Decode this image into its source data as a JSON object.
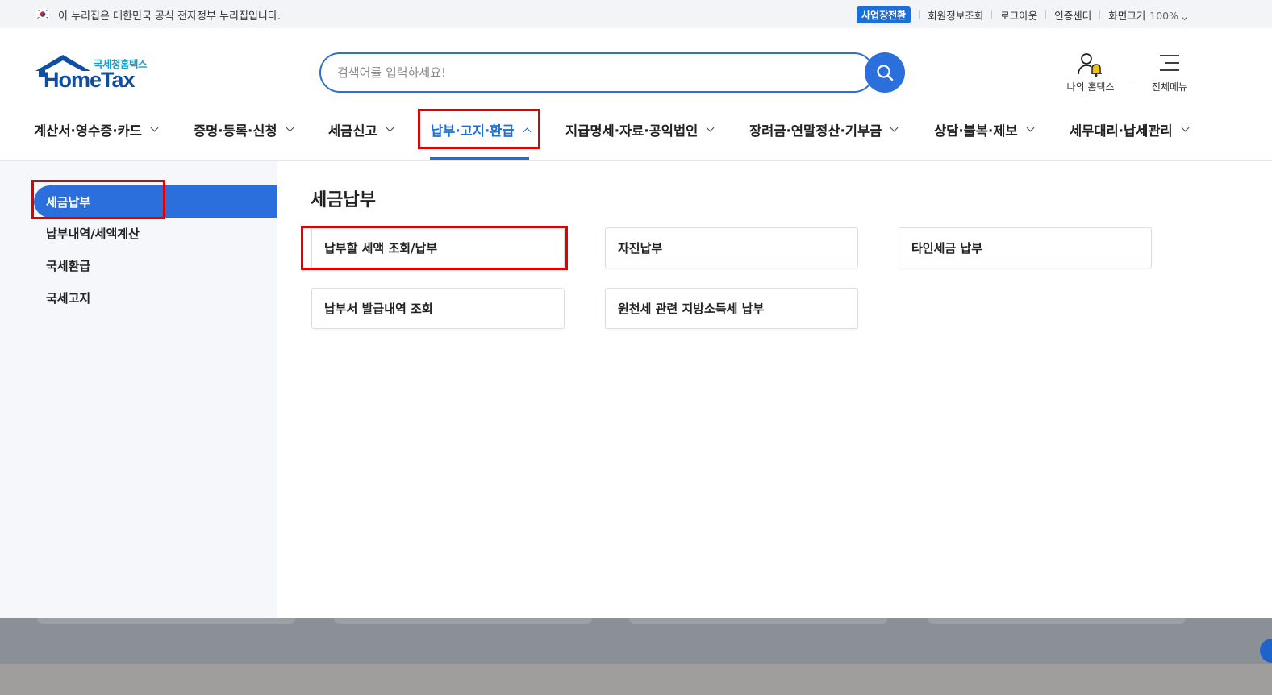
{
  "gov_banner": {
    "text": "이 누리집은 대한민국 공식 전자정부 누리집입니다.",
    "flag_icon": "korea-flag-icon"
  },
  "utility": {
    "switch_business": "사업장전환",
    "member_info": "회원정보조회",
    "logout": "로그아웃",
    "cert_center": "인증센터",
    "screen_size": "화면크기",
    "zoom": "100%"
  },
  "logo": {
    "sub": "국세청홈택스",
    "main": "HomeTax"
  },
  "search": {
    "placeholder": "검색어를 입력하세요!",
    "value": ""
  },
  "header_links": {
    "my_hometax": "나의 홈택스",
    "all_menu": "전체메뉴"
  },
  "gnb": {
    "items": [
      {
        "label": "계산서·영수증·카드",
        "active": false
      },
      {
        "label": "증명·등록·신청",
        "active": false
      },
      {
        "label": "세금신고",
        "active": false
      },
      {
        "label": "납부·고지·환급",
        "active": true
      },
      {
        "label": "지급명세·자료·공익법인",
        "active": false
      },
      {
        "label": "장려금·연말정산·기부금",
        "active": false
      },
      {
        "label": "상담·불복·제보",
        "active": false
      },
      {
        "label": "세무대리·납세관리",
        "active": false
      }
    ]
  },
  "lnb": {
    "items": [
      "세금납부",
      "납부내역/세액계산",
      "국세환급",
      "국세고지"
    ],
    "active_index": 0
  },
  "content": {
    "title": "세금납부",
    "cards": [
      "납부할 세액 조회/납부",
      "자진납부",
      "타인세금 납부",
      "납부서 발급내역 조회",
      "원천세 관련 지방소득세 납부"
    ]
  },
  "colors": {
    "primary": "#2a6fdb",
    "highlight": "#e00000",
    "logo_blue": "#0f4ea3"
  }
}
